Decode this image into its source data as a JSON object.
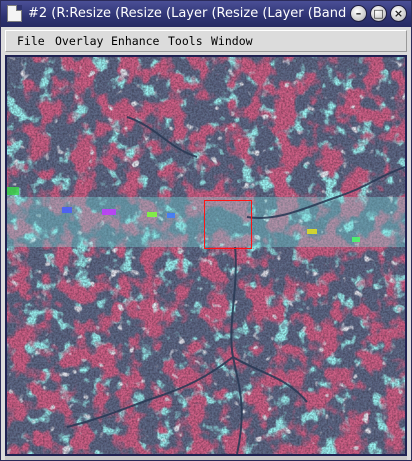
{
  "window": {
    "title": "#2 (R:Resize (Resize (Layer (Resize (Layer (Band",
    "controls": {
      "minimize_glyph": "–",
      "maximize_glyph": "□",
      "close_glyph": "×"
    }
  },
  "menu": {
    "items": [
      "File",
      "Overlay",
      "Enhance",
      "Tools",
      "Window"
    ]
  },
  "image": {
    "description_colors": {
      "vegetation": "#9e1f3c",
      "bare_soil": "#55e6e0",
      "water": "#2a3a55",
      "mixed": "#b9c8d2"
    },
    "zoom_box_color": "#ff1414"
  },
  "colors": {
    "titlebar": "#2e3372",
    "frame": "#1f2252",
    "chrome": "#dcdcdc"
  }
}
